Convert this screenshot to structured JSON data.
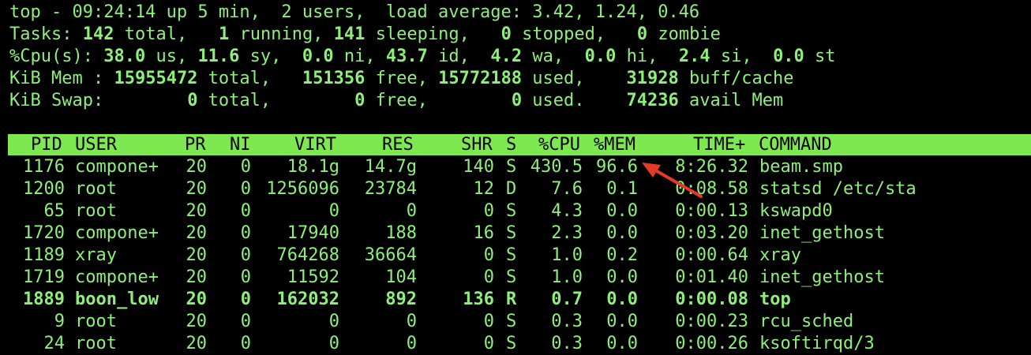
{
  "summary": {
    "line1": "top - 09:24:14 up 5 min,  2 users,  load average: 3.42, 1.24, 0.46",
    "tasks": {
      "label": "Tasks:",
      "total": "142",
      "total_label": "total,",
      "running": "1",
      "running_label": "running,",
      "sleeping": "141",
      "sleeping_label": "sleeping,",
      "stopped": "0",
      "stopped_label": "stopped,",
      "zombie": "0",
      "zombie_label": "zombie"
    },
    "cpu": {
      "label": "%Cpu(s):",
      "us": "38.0",
      "sy": "11.6",
      "ni": "0.0",
      "id": "43.7",
      "wa": "4.2",
      "hi": "0.0",
      "si": "2.4",
      "st": "0.0"
    },
    "mem": {
      "label": "KiB Mem :",
      "total": "15955472",
      "free": "151356",
      "used": "15772188",
      "buff": "31928"
    },
    "swap": {
      "label": "KiB Swap:",
      "total": "0",
      "free": "0",
      "used": "0",
      "avail": "74236"
    }
  },
  "columns": [
    "PID",
    "USER",
    "PR",
    "NI",
    "VIRT",
    "RES",
    "SHR",
    "S",
    "%CPU",
    "%MEM",
    "TIME+",
    "COMMAND"
  ],
  "processes": [
    {
      "pid": "1176",
      "user": "compone+",
      "pr": "20",
      "ni": "0",
      "virt": "18.1g",
      "res": "14.7g",
      "shr": "140",
      "s": "S",
      "cpu": "430.5",
      "mem": "96.6",
      "time": "8:26.32",
      "cmd": "beam.smp",
      "bold": false
    },
    {
      "pid": "1200",
      "user": "root",
      "pr": "20",
      "ni": "0",
      "virt": "1256096",
      "res": "23784",
      "shr": "12",
      "s": "D",
      "cpu": "7.6",
      "mem": "0.1",
      "time": "0:08.58",
      "cmd": "statsd /etc/sta",
      "bold": false
    },
    {
      "pid": "65",
      "user": "root",
      "pr": "20",
      "ni": "0",
      "virt": "0",
      "res": "0",
      "shr": "0",
      "s": "S",
      "cpu": "4.3",
      "mem": "0.0",
      "time": "0:00.13",
      "cmd": "kswapd0",
      "bold": false
    },
    {
      "pid": "1720",
      "user": "compone+",
      "pr": "20",
      "ni": "0",
      "virt": "17940",
      "res": "188",
      "shr": "16",
      "s": "S",
      "cpu": "2.3",
      "mem": "0.0",
      "time": "0:03.20",
      "cmd": "inet_gethost",
      "bold": false
    },
    {
      "pid": "1189",
      "user": "xray",
      "pr": "20",
      "ni": "0",
      "virt": "764268",
      "res": "36664",
      "shr": "0",
      "s": "S",
      "cpu": "1.0",
      "mem": "0.2",
      "time": "0:00.64",
      "cmd": "xray",
      "bold": false
    },
    {
      "pid": "1719",
      "user": "compone+",
      "pr": "20",
      "ni": "0",
      "virt": "11592",
      "res": "104",
      "shr": "0",
      "s": "S",
      "cpu": "1.0",
      "mem": "0.0",
      "time": "0:01.40",
      "cmd": "inet_gethost",
      "bold": false
    },
    {
      "pid": "1889",
      "user": "boon_low",
      "pr": "20",
      "ni": "0",
      "virt": "162032",
      "res": "892",
      "shr": "136",
      "s": "R",
      "cpu": "0.7",
      "mem": "0.0",
      "time": "0:00.08",
      "cmd": "top",
      "bold": true
    },
    {
      "pid": "9",
      "user": "root",
      "pr": "20",
      "ni": "0",
      "virt": "0",
      "res": "0",
      "shr": "0",
      "s": "S",
      "cpu": "0.3",
      "mem": "0.0",
      "time": "0:00.23",
      "cmd": "rcu_sched",
      "bold": false
    },
    {
      "pid": "24",
      "user": "root",
      "pr": "20",
      "ni": "0",
      "virt": "0",
      "res": "0",
      "shr": "0",
      "s": "S",
      "cpu": "0.3",
      "mem": "0.0",
      "time": "0:00.26",
      "cmd": "ksoftirqd/3",
      "bold": false
    }
  ],
  "colors": {
    "text": "#8ef07a",
    "header_bg": "#7de84f",
    "arrow": "#e53a2a",
    "background": "#000000"
  },
  "annotation": {
    "icon": "red-arrow-icon"
  }
}
